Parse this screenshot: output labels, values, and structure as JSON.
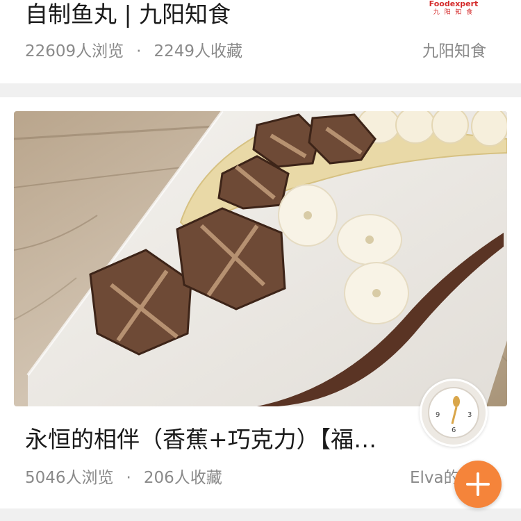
{
  "cards": [
    {
      "title": "自制鱼丸 | 九阳知食",
      "views": "22609人浏览",
      "separator": "·",
      "favorites": "2249人收藏",
      "author": "九阳知食",
      "logo": {
        "top": "Foodexpert",
        "bottom": "九 阳 知 食"
      }
    },
    {
      "title": "永恒的相伴（香蕉+巧克力）【福…",
      "views": "5046人浏览",
      "separator": "·",
      "favorites": "206人收藏",
      "author": "Elva的"
    }
  ],
  "colors": {
    "accent": "#f5843a",
    "title_text": "#1a1a1a",
    "meta_text": "#8a8a8a",
    "page_bg": "#f0f0f0"
  },
  "icons": {
    "add": "plus-icon"
  }
}
